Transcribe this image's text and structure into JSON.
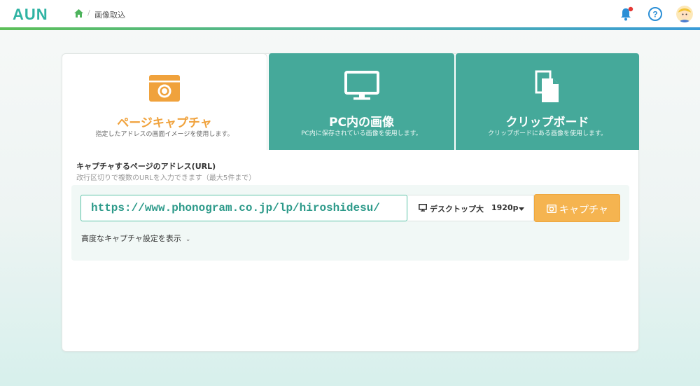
{
  "header": {
    "logo_text": "AUN",
    "breadcrumb_sep": "/",
    "breadcrumb_current": "画像取込",
    "accent_gradient": [
      "#5cbf58",
      "#4db3a8",
      "#3a9bd8"
    ]
  },
  "tabs": [
    {
      "title": "ページキャプチャ",
      "subtitle": "指定したアドレスの画面イメージを使用します。",
      "icon": "camera-icon",
      "active": true
    },
    {
      "title": "PC内の画像",
      "subtitle": "PC内に保存されている画像を使用します。",
      "icon": "monitor-icon",
      "active": false
    },
    {
      "title": "クリップボード",
      "subtitle": "クリップボードにある画像を使用します。",
      "icon": "clipboard-icon",
      "active": false
    }
  ],
  "form": {
    "label": "キャプチャするページのアドレス(URL)",
    "hint": "改行区切りで複数のURLを入力できます（最大5件まで）",
    "url_value": "https://www.phonogram.co.jp/lp/hiroshidesu/",
    "device_label": "デスクトップ大",
    "resolution": "1920p",
    "capture_button": "キャプチャ",
    "advanced_toggle": "高度なキャプチャ設定を表示"
  },
  "colors": {
    "teal": "#45a99a",
    "orange": "#f0a23c",
    "button": "#f5b450"
  }
}
